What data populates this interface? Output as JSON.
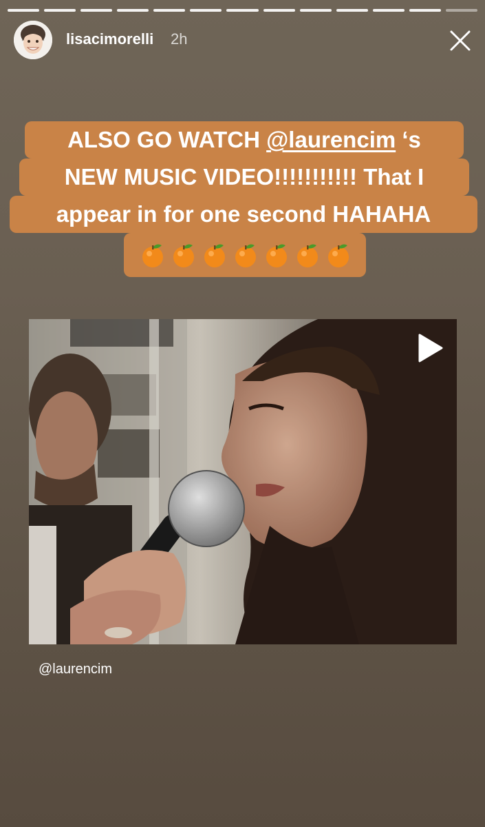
{
  "story": {
    "segments_total": 13,
    "current_segment": 12
  },
  "header": {
    "username": "lisacimorelli",
    "time": "2h",
    "close_icon": "close-icon"
  },
  "caption": {
    "line1_prefix": "ALSO GO WATCH ",
    "line1_mention": "@laurencim",
    "line1_suffix": " ‘s",
    "line2": "NEW MUSIC VIDEO!!!!!!!!!!! That I",
    "line3": "appear in for one second HAHAHA",
    "emoji": "🍊",
    "emoji_count": 7,
    "background_color": "#c98347"
  },
  "video": {
    "play_icon": "play-icon"
  },
  "mention_sticker": {
    "label": "@laurencim"
  }
}
